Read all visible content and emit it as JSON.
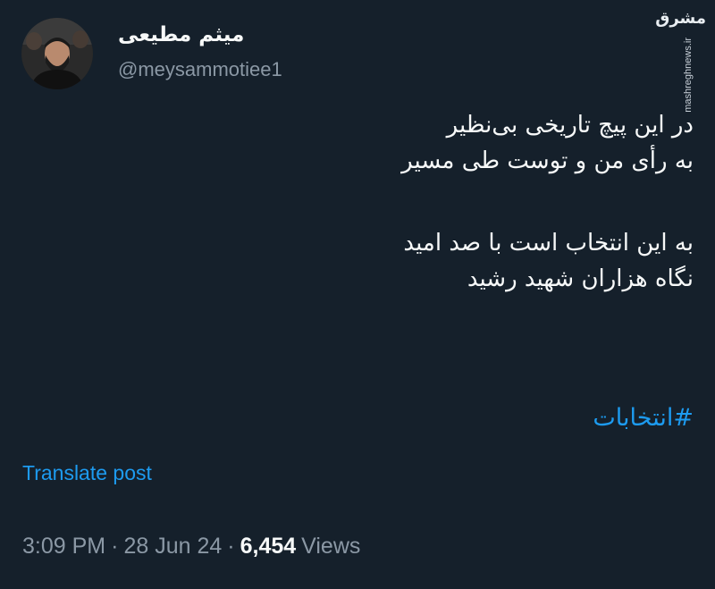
{
  "author": {
    "display_name": "میثم مطیعی",
    "handle": "@meysammotiee1",
    "avatar_icon": "profile-photo"
  },
  "watermark": {
    "logo_text": "مشرق",
    "site": "mashreghnews.ir"
  },
  "tweet": {
    "lines": [
      "در این پیچ تاریخی بی‌نظیر",
      "به رأی من و توست طی مسیر",
      "",
      "به این انتخاب است با صد امید",
      "نگاه هزاران شهید رشید"
    ],
    "hashtag": "#انتخابات",
    "translate_label": "Translate post"
  },
  "meta": {
    "time": "3:09 PM",
    "date": "28 Jun 24",
    "separator": "·",
    "views_count": "6,454",
    "views_label": "Views"
  },
  "colors": {
    "background": "#15202b",
    "primary_text": "#f7f9f9",
    "secondary_text": "#8b98a5",
    "link": "#1d9bf0"
  }
}
